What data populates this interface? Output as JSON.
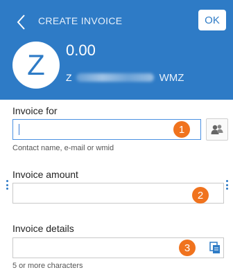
{
  "header": {
    "title": "CREATE INVOICE",
    "ok_label": "OK",
    "avatar_letter": "Z",
    "amount": "0.00",
    "purse_prefix": "Z",
    "purse_suffix": "WMZ",
    "background_color": "#2e7bc6"
  },
  "form": {
    "invoice_for": {
      "label": "Invoice for",
      "value": "",
      "helper": "Contact name, e-mail or wmid",
      "step_number": "1",
      "side_icon": "contacts-icon"
    },
    "invoice_amount": {
      "label": "Invoice amount",
      "value": "",
      "step_number": "2"
    },
    "invoice_details": {
      "label": "Invoice details",
      "value": "",
      "helper": "5 or more characters",
      "step_number": "3",
      "side_icon": "paste-icon"
    }
  },
  "colors": {
    "accent": "#2e7bc6",
    "step_badge": "#f0731e"
  }
}
